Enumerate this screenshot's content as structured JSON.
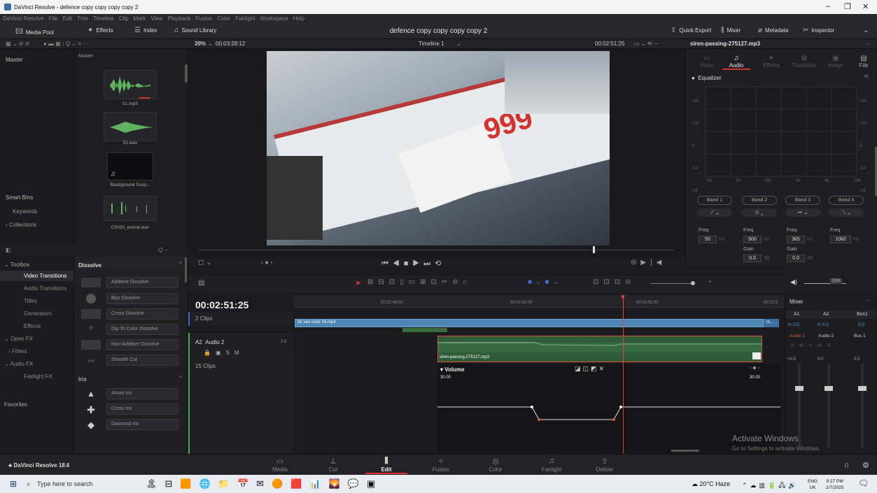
{
  "window": {
    "title": "DaVinci Resolve - defence copy copy copy copy 2"
  },
  "menu": [
    "DaVinci Resolve",
    "File",
    "Edit",
    "Trim",
    "Timeline",
    "Clip",
    "Mark",
    "View",
    "Playback",
    "Fusion",
    "Color",
    "Fairlight",
    "Workspace",
    "Help"
  ],
  "toolbar": {
    "media_pool": "Media Pool",
    "effects": "Effects",
    "index": "Index",
    "sound_library": "Sound Library",
    "project_title": "defence copy copy copy copy 2",
    "quick_export": "Quick Export",
    "mixer": "Mixer",
    "metadata": "Metadata",
    "inspector": "Inspector"
  },
  "subbar": {
    "zoom": "39%",
    "source_timecode": "00:03:28:12",
    "timeline_name": "Timeline 1",
    "record_timecode": "00:02:51:25",
    "clip_name": "siren-passing-275127.mp3"
  },
  "bins": {
    "master": "Master",
    "master_header": "Master",
    "smart_bins": "Smart Bins",
    "keywords": "Keywords",
    "collections": "Collections"
  },
  "media_clips": [
    {
      "name": "01.mp3",
      "kind": "audio"
    },
    {
      "name": "02.wav",
      "kind": "audio"
    },
    {
      "name": "Background Susp...",
      "kind": "video"
    },
    {
      "name": "C0020_eshrat.wav",
      "kind": "audio"
    }
  ],
  "toolbox": {
    "items": [
      "Toolbox",
      "Video Transitions",
      "Audio Transitions",
      "Titles",
      "Generators",
      "Effects",
      "Open FX",
      "Filters",
      "Audio FX",
      "Fairlight FX"
    ],
    "favorites": "Favorites"
  },
  "fx": {
    "dissolve_header": "Dissolve",
    "dissolve": [
      "Additive Dissolve",
      "Blur Dissolve",
      "Cross Dissolve",
      "Dip To Color Dissolve",
      "Non-Additive Dissolve",
      "Smooth Cut"
    ],
    "iris_header": "Iris",
    "iris": [
      "Arrow Iris",
      "Cross Iris",
      "Diamond Iris"
    ]
  },
  "inspector": {
    "tabs": [
      "Video",
      "Audio",
      "Effects",
      "Transition",
      "Image",
      "File"
    ],
    "active_tab": "Audio",
    "equalizer": "Equalizer",
    "y_labels": [
      "+24",
      "+12",
      "0",
      "-12",
      "-24"
    ],
    "x_labels": [
      "Hz",
      "50",
      "200",
      "1K",
      "4K",
      "10K"
    ],
    "bands": [
      "Band 1",
      "Band 2",
      "Band 3",
      "Band 4"
    ],
    "freq_label": "Freq",
    "freqs": [
      "50",
      "500",
      "3k5",
      "10k0"
    ],
    "hz": "Hz",
    "gain_label": "Gain",
    "gains": [
      "0.0",
      "0.0"
    ],
    "db": "dB"
  },
  "timeline": {
    "timecode": "00:02:51:25",
    "ruler": [
      "00:02:48:00",
      "00:02:50:00",
      "00:02:52:00",
      "00:02:5"
    ],
    "video_clips_count": "2 Clips",
    "video_clip_name": "for see color 04.mp4",
    "video_clip_end": "In...",
    "audio_track_id": "A2",
    "audio_track_name": "Audio 2",
    "audio_track_ch": "2.0",
    "audio_clips_count": "15 Clips",
    "audio_clip_name": "siren-passing-275127.mp3",
    "volume_label": "Volume",
    "volume_left": "30.00",
    "volume_right": "30.00",
    "dim": "DIM"
  },
  "mixer": {
    "title": "Mixer",
    "channels": [
      "A1",
      "A2",
      "Bus1"
    ],
    "eq": "fx EQ",
    "routes": [
      "Audio 1",
      "Audio 2",
      "Bus 1"
    ],
    "levels": [
      "+0.5",
      "0.0",
      "0.0"
    ]
  },
  "pages": [
    "Media",
    "Cut",
    "Edit",
    "Fusion",
    "Color",
    "Fairlight",
    "Deliver"
  ],
  "active_page": "Edit",
  "app_version": "DaVinci Resolve 18.6",
  "watermark": {
    "line1": "Activate Windows",
    "line2": "Go to Settings to activate Windows."
  },
  "taskbar": {
    "search": "Type here to search",
    "weather": "20°C Haze",
    "lang1": "ENG",
    "lang2": "UK",
    "time": "9:27 PM",
    "date": "1/7/2025"
  }
}
